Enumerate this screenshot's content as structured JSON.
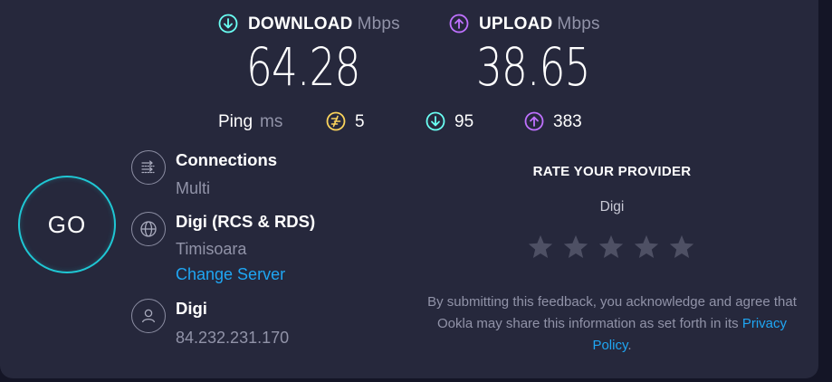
{
  "download": {
    "label": "DOWNLOAD",
    "unit": "Mbps",
    "value": "64.28",
    "icon": "download-arrow-icon",
    "color": "#6afff3"
  },
  "upload": {
    "label": "UPLOAD",
    "unit": "Mbps",
    "value": "38.65",
    "icon": "upload-arrow-icon",
    "color": "#bf71ff"
  },
  "ping": {
    "label": "Ping",
    "unit": "ms",
    "idle": "5",
    "download": "95",
    "upload": "383",
    "idle_color": "#fbd45c"
  },
  "go_button": {
    "label": "GO",
    "ring_color": "#1fc7d4"
  },
  "connections": {
    "title": "Connections",
    "value": "Multi",
    "icon": "connections-icon"
  },
  "server": {
    "title": "Digi (RCS & RDS)",
    "location": "Timisoara",
    "change_link": "Change Server",
    "icon": "globe-icon"
  },
  "provider": {
    "title": "Digi",
    "ip": "84.232.231.170",
    "icon": "user-icon"
  },
  "rate": {
    "title": "RATE YOUR PROVIDER",
    "provider_name": "Digi",
    "star_count": 5,
    "disclaimer_text": "By submitting this feedback, you acknowledge and agree that Ookla may share this information as set forth in its ",
    "privacy_link": "Privacy Policy",
    "disclaimer_end": "."
  },
  "colors": {
    "background": "#141526",
    "card": "#26283c",
    "muted_text": "#9193a8",
    "link": "#1fa6f3",
    "star": "#4e5064"
  }
}
